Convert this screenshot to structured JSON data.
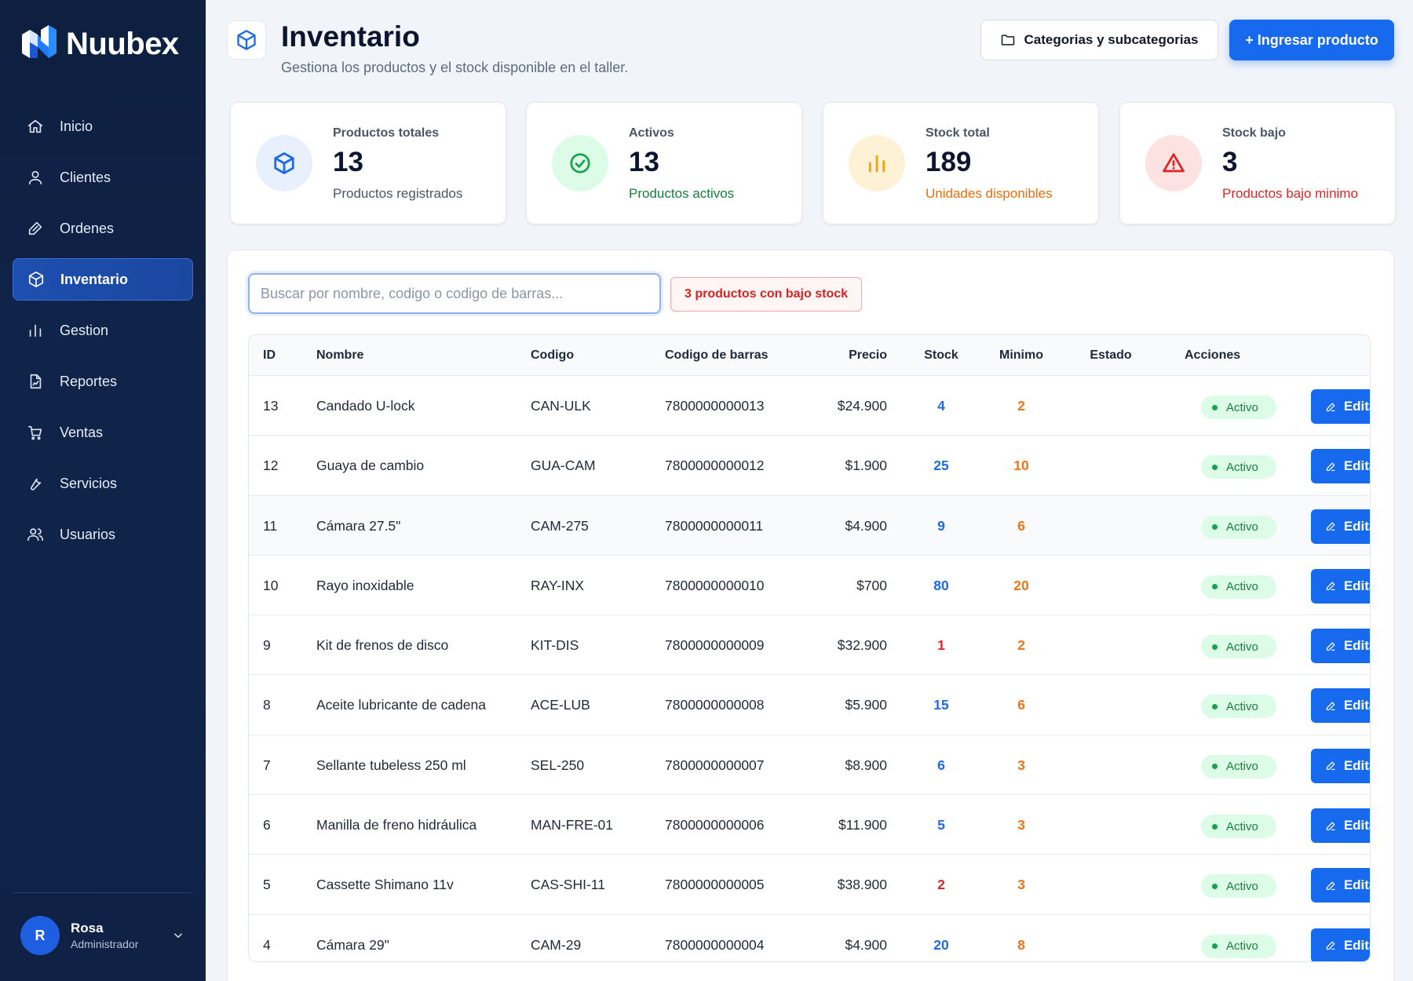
{
  "brand": {
    "name": "Nuubex"
  },
  "nav": [
    {
      "label": "Inicio",
      "icon": "home-icon"
    },
    {
      "label": "Clientes",
      "icon": "user-icon"
    },
    {
      "label": "Ordenes",
      "icon": "tag-icon"
    },
    {
      "label": "Inventario",
      "icon": "box-icon",
      "active": true
    },
    {
      "label": "Gestion",
      "icon": "bar-chart-icon"
    },
    {
      "label": "Reportes",
      "icon": "report-icon"
    },
    {
      "label": "Ventas",
      "icon": "cart-icon"
    },
    {
      "label": "Servicios",
      "icon": "wrench-icon"
    },
    {
      "label": "Usuarios",
      "icon": "users-icon"
    }
  ],
  "user": {
    "initial": "R",
    "name": "Rosa",
    "role": "Administrador"
  },
  "header": {
    "title": "Inventario",
    "subtitle": "Gestiona los productos y el stock disponible en el taller.",
    "categories_button": "Categorias y subcategorias",
    "add_button": "+ Ingresar producto"
  },
  "stats": [
    {
      "label": "Productos totales",
      "value": "13",
      "desc": "Productos registrados",
      "desc_color": "#4a5568",
      "icon": "box-icon",
      "bg": "#e8f0fd",
      "stroke": "#1d6ae5"
    },
    {
      "label": "Activos",
      "value": "13",
      "desc": "Productos activos",
      "desc_color": "#15803d",
      "icon": "check-circle-icon",
      "bg": "#dcfce7",
      "stroke": "#16a34a"
    },
    {
      "label": "Stock total",
      "value": "189",
      "desc": "Unidades disponibles",
      "desc_color": "#ea6c0c",
      "icon": "bar-chart-icon",
      "bg": "#fdf1d6",
      "stroke": "#f59e0b"
    },
    {
      "label": "Stock bajo",
      "value": "3",
      "desc": "Productos bajo minimo",
      "desc_color": "#dc2626",
      "icon": "warning-icon",
      "bg": "#fde2e2",
      "stroke": "#dc2626"
    }
  ],
  "search": {
    "placeholder": "Buscar por nombre, codigo o codigo de barras...",
    "value": ""
  },
  "low_stock_badge": "3 productos con bajo stock",
  "table": {
    "columns": [
      "ID",
      "Nombre",
      "Codigo",
      "Codigo de barras",
      "Precio",
      "Stock",
      "Minimo",
      "Estado",
      "Acciones"
    ],
    "edit_label": "Editar",
    "rows": [
      {
        "id": "13",
        "nombre": "Candado U-lock",
        "codigo": "CAN-ULK",
        "barras": "7800000000013",
        "precio": "$24.900",
        "stock": "4",
        "minimo": "2",
        "estado": "Activo",
        "stock_color": "#1d6ae5"
      },
      {
        "id": "12",
        "nombre": "Guaya de cambio",
        "codigo": "GUA-CAM",
        "barras": "7800000000012",
        "precio": "$1.900",
        "stock": "25",
        "minimo": "10",
        "estado": "Activo",
        "stock_color": "#1d6ae5"
      },
      {
        "id": "11",
        "nombre": "Cámara 27.5\"",
        "codigo": "CAM-275",
        "barras": "7800000000011",
        "precio": "$4.900",
        "stock": "9",
        "minimo": "6",
        "estado": "Activo",
        "stock_color": "#1d6ae5"
      },
      {
        "id": "10",
        "nombre": "Rayo inoxidable",
        "codigo": "RAY-INX",
        "barras": "7800000000010",
        "precio": "$700",
        "stock": "80",
        "minimo": "20",
        "estado": "Activo",
        "stock_color": "#1d6ae5"
      },
      {
        "id": "9",
        "nombre": "Kit de frenos de disco",
        "codigo": "KIT-DIS",
        "barras": "7800000000009",
        "precio": "$32.900",
        "stock": "1",
        "minimo": "2",
        "estado": "Activo",
        "stock_color": "#dc2626"
      },
      {
        "id": "8",
        "nombre": "Aceite lubricante de cadena",
        "codigo": "ACE-LUB",
        "barras": "7800000000008",
        "precio": "$5.900",
        "stock": "15",
        "minimo": "6",
        "estado": "Activo",
        "stock_color": "#1d6ae5"
      },
      {
        "id": "7",
        "nombre": "Sellante tubeless 250 ml",
        "codigo": "SEL-250",
        "barras": "7800000000007",
        "precio": "$8.900",
        "stock": "6",
        "minimo": "3",
        "estado": "Activo",
        "stock_color": "#1d6ae5"
      },
      {
        "id": "6",
        "nombre": "Manilla de freno hidráulica",
        "codigo": "MAN-FRE-01",
        "barras": "7800000000006",
        "precio": "$11.900",
        "stock": "5",
        "minimo": "3",
        "estado": "Activo",
        "stock_color": "#1d6ae5"
      },
      {
        "id": "5",
        "nombre": "Cassette Shimano 11v",
        "codigo": "CAS-SHI-11",
        "barras": "7800000000005",
        "precio": "$38.900",
        "stock": "2",
        "minimo": "3",
        "estado": "Activo",
        "stock_color": "#dc2626"
      },
      {
        "id": "4",
        "nombre": "Cámara 29\"",
        "codigo": "CAM-29",
        "barras": "7800000000004",
        "precio": "$4.900",
        "stock": "20",
        "minimo": "8",
        "estado": "Activo",
        "stock_color": "#1d6ae5"
      }
    ]
  }
}
